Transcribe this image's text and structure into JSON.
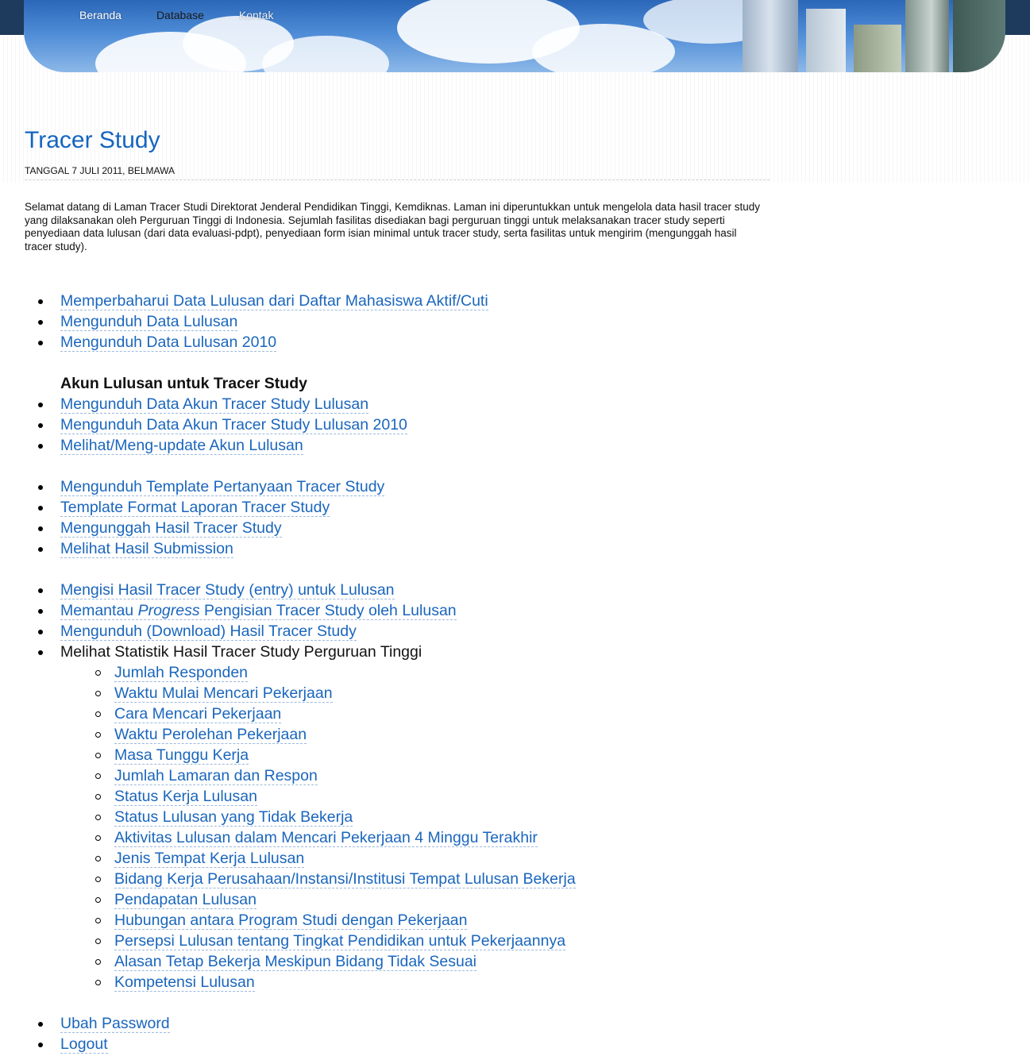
{
  "nav": [
    "Beranda",
    "Database",
    "Kontak"
  ],
  "page": {
    "title": "Tracer Study",
    "meta": "TANGGAL 7 JULI 2011, BELMAWA",
    "intro": "Selamat datang di Laman Tracer Studi Direktorat Jenderal Pendidikan Tinggi, Kemdiknas. Laman ini diperuntukkan untuk mengelola data hasil tracer study yang dilaksanakan oleh Perguruan Tinggi di Indonesia. Sejumlah fasilitas disediakan bagi perguruan tinggi untuk melaksanakan tracer study seperti penyediaan data lulusan (dari data evaluasi-pdpt), penyediaan form isian minimal untuk tracer study, serta fasilitas untuk mengirim (mengunggah hasil tracer study)."
  },
  "group1": [
    "Memperbaharui Data Lulusan dari Daftar Mahasiswa Aktif/Cuti",
    "Mengunduh Data Lulusan",
    "Mengunduh Data Lulusan 2010"
  ],
  "group2_heading": "Akun Lulusan untuk Tracer Study",
  "group2": [
    "Mengunduh Data Akun Tracer Study Lulusan",
    "Mengunduh Data Akun Tracer Study Lulusan 2010",
    "Melihat/Meng-update Akun Lulusan"
  ],
  "group3": [
    "Mengunduh Template Pertanyaan Tracer Study",
    "Template Format Laporan Tracer Study",
    "Mengunggah Hasil Tracer Study",
    "Melihat Hasil Submission"
  ],
  "group4": {
    "entry": "Mengisi Hasil Tracer Study (entry) untuk Lulusan",
    "progress_pre": "Memantau ",
    "progress_em": "Progress",
    "progress_post": " Pengisian Tracer Study oleh Lulusan",
    "download": "Mengunduh (Download) Hasil Tracer Study",
    "stats": "Melihat Statistik Hasil Tracer Study Perguruan Tinggi"
  },
  "stats_items": [
    "Jumlah Responden",
    "Waktu Mulai Mencari Pekerjaan",
    "Cara Mencari Pekerjaan",
    "Waktu Perolehan Pekerjaan",
    "Masa Tunggu Kerja",
    "Jumlah Lamaran dan Respon",
    "Status Kerja Lulusan",
    "Status Lulusan yang Tidak Bekerja",
    "Aktivitas Lulusan dalam Mencari Pekerjaan 4 Minggu Terakhir",
    "Jenis Tempat Kerja Lulusan",
    "Bidang Kerja Perusahaan/Instansi/Institusi Tempat Lulusan Bekerja",
    "Pendapatan Lulusan",
    "Hubungan antara Program Studi dengan Pekerjaan",
    "Persepsi Lulusan tentang Tingkat Pendidikan untuk Pekerjaannya",
    "Alasan Tetap Bekerja Meskipun Bidang Tidak Sesuai",
    "Kompetensi Lulusan"
  ],
  "group5": [
    "Ubah Password",
    "Logout"
  ]
}
